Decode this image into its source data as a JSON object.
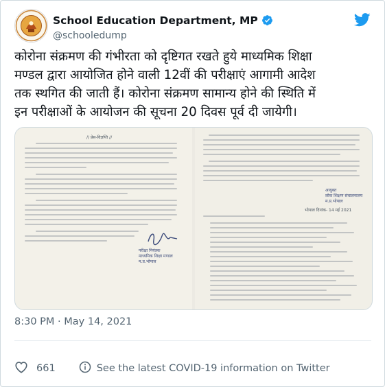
{
  "account": {
    "name": "School Education Department, MP",
    "handle": "@schooledump"
  },
  "tweet": {
    "lines": [
      "कोरोना संक्रमण की गंभीरता को दृष्टिगत रखते हुये माध्यमिक शिक्षा",
      "मण्डल द्वारा आयोजित होने वाली 12वीं की परीक्षाएं आगामी आदेश",
      "तक स्थगित की जाती हैं। कोरोना संक्रमण सामान्य होने की स्थिति में",
      "इन परीक्षाओं के आयोजन की सूचना 20 दिवस पूर्व दी जायेगी।"
    ],
    "timestamp": "8:30 PM · May 14, 2021"
  },
  "media": {
    "left_doc_header": "// प्रेस-विज्ञप्ति //",
    "left_doc_stamp": [
      "परीक्षा नियंत्रक",
      "माध्यमिक शिक्षा मण्डल",
      "म.प्र.भोपाल"
    ],
    "right_doc_stamp": [
      "आयुक्त",
      "लोक शिक्षण संचालनालय",
      "म.प्र.भोपाल"
    ],
    "right_doc_date": "भोपाल दिनांक- 14 मई 2021"
  },
  "footer": {
    "like_count": "661",
    "covid_info": "See the latest COVID-19 information on Twitter"
  },
  "colors": {
    "twitter_blue": "#1d9bf0",
    "like_red": "#f91880",
    "text": "#0f1419",
    "muted": "#536471"
  },
  "icons": [
    "seal-logo",
    "verified-badge-icon",
    "twitter-bird-icon",
    "heart-icon",
    "info-icon"
  ]
}
